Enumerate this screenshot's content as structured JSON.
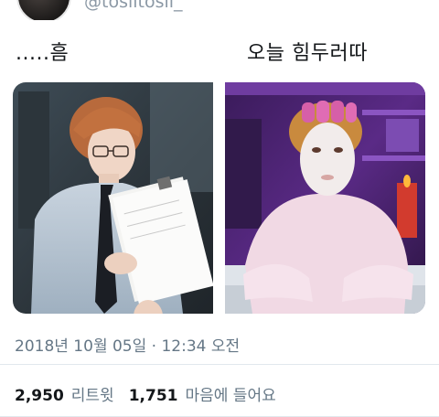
{
  "tweet": {
    "handle": "@tosiltosil_",
    "captions": {
      "left": ".....흠",
      "right": "오늘 힘두러따"
    },
    "media": [
      {
        "description": "man in glasses and shirt reading documents"
      },
      {
        "description": "person with face mask and hair rollers lying on bed"
      }
    ],
    "timestamp": "2018년 10월 05일 · 12:34 오전",
    "stats": {
      "retweets_count": "2,950",
      "retweets_label": "리트윗",
      "likes_count": "1,751",
      "likes_label": "마음에 들어요"
    }
  },
  "colors": {
    "text_primary": "#14171a",
    "text_secondary": "#657786",
    "divider": "#e1e8ed"
  }
}
